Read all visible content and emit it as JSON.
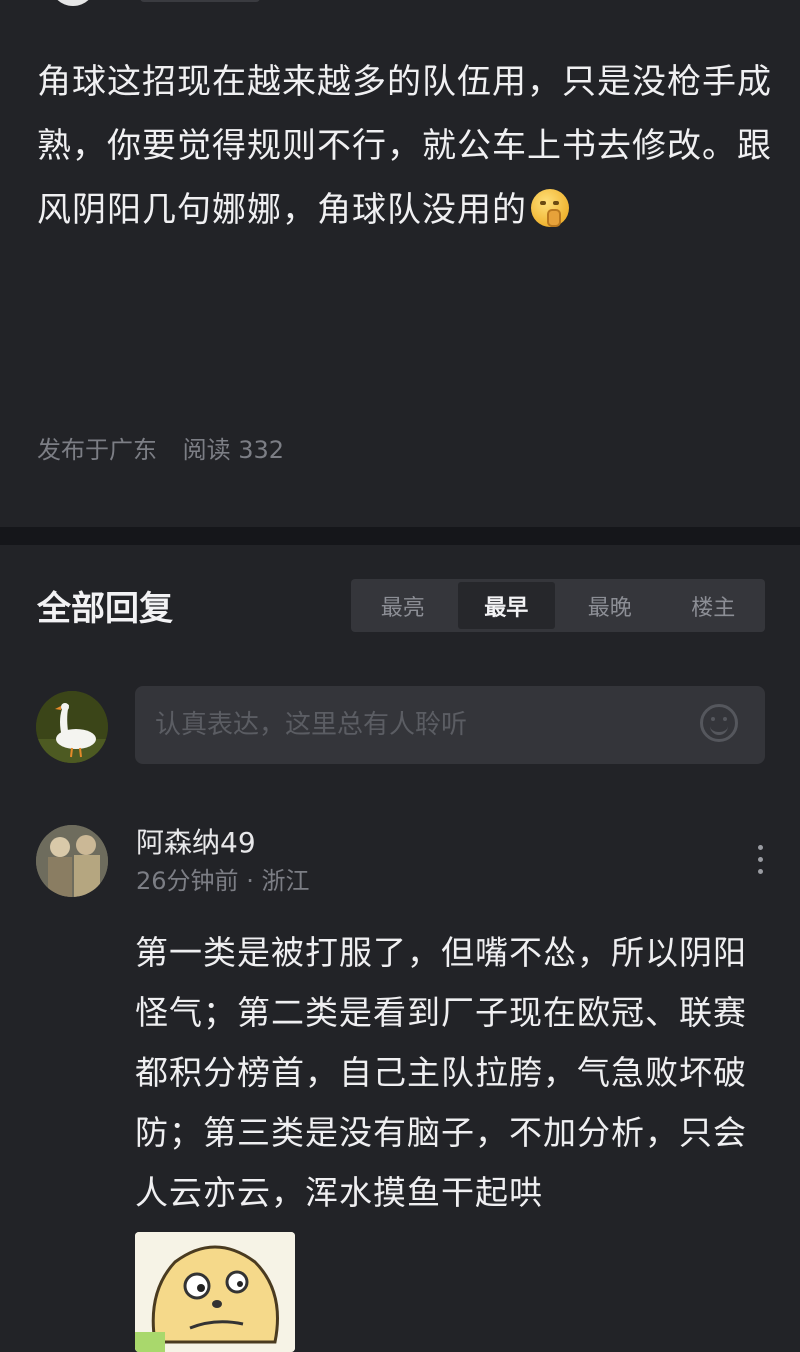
{
  "post": {
    "body": "角球这招现在越来越多的队伍用，只是没枪手成熟，你要觉得规则不行，就公车上书去修改。跟风阴阳几句娜娜，角球队没用的",
    "emoji": "shushing-face-emoji",
    "location": "发布于广东",
    "reads": "阅读 332"
  },
  "replies": {
    "title": "全部回复",
    "sort_tabs": [
      "最亮",
      "最早",
      "最晚",
      "楼主"
    ],
    "active_tab": "最早"
  },
  "composer": {
    "placeholder": "认真表达，这里总有人聆听",
    "avatar": "goose-avatar",
    "emoji_button": "smiley-icon"
  },
  "comment": {
    "author": "阿森纳49",
    "time": "26分钟前",
    "separator": "·",
    "location": "浙江",
    "body": "第一类是被打服了，但嘴不怂，所以阴阳怪气；第二类是看到厂子现在欧冠、联赛都积分榜首，自己主队拉胯，气急败坏破防；第三类是没有脑子，不加分析，只会人云亦云，浑水摸鱼干起哄",
    "sticker": "confused-cartoon-sticker"
  },
  "colors": {
    "background": "#1f2024",
    "card": "#222327",
    "muted_text": "#7c7e85",
    "active_tab_bg": "#26272b"
  }
}
